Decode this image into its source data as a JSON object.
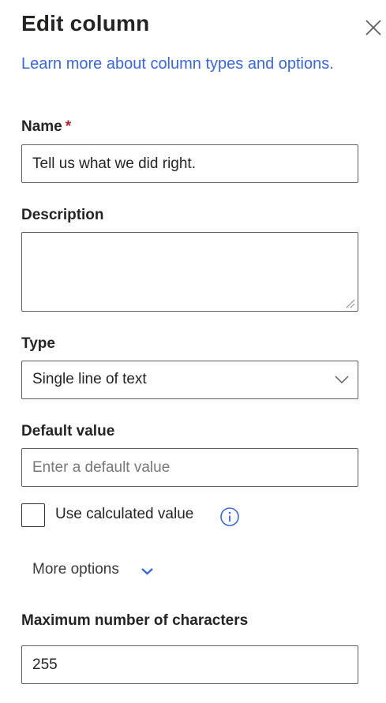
{
  "panel": {
    "title": "Edit column",
    "learn_more_link": "Learn more about column types and options."
  },
  "name_field": {
    "label": "Name",
    "required_marker": "*",
    "value": "Tell us what we did right."
  },
  "description_field": {
    "label": "Description",
    "value": ""
  },
  "type_field": {
    "label": "Type",
    "selected": "Single line of text"
  },
  "default_value_field": {
    "label": "Default value",
    "placeholder": "Enter a default value",
    "value": ""
  },
  "calculated_value": {
    "label": "Use calculated value",
    "checked": false
  },
  "more_options": {
    "label": "More options"
  },
  "max_chars_field": {
    "label": "Maximum number of characters",
    "value": "255"
  },
  "colors": {
    "link": "#3b67d6",
    "required": "#a4262c",
    "border": "#605e5c",
    "text": "#252423"
  },
  "icons": {
    "close": "close-icon",
    "dropdown": "chevron-down-icon",
    "info": "info-icon",
    "more": "chevron-down-icon"
  }
}
